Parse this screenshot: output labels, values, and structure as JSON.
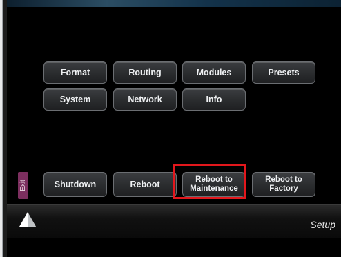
{
  "menu": {
    "format": "Format",
    "routing": "Routing",
    "modules": "Modules",
    "presets": "Presets",
    "system": "System",
    "network": "Network",
    "info": "Info"
  },
  "power": {
    "exit": "Exit",
    "shutdown": "Shutdown",
    "reboot": "Reboot",
    "reboot_maintenance": "Reboot to\nMaintenance",
    "reboot_factory": "Reboot to\nFactory"
  },
  "footer": {
    "screen_label": "Setup",
    "home_icon": "home-triangle-icon"
  },
  "colors": {
    "highlight": "#e2171c",
    "exit_tab": "#7c2f5f"
  }
}
